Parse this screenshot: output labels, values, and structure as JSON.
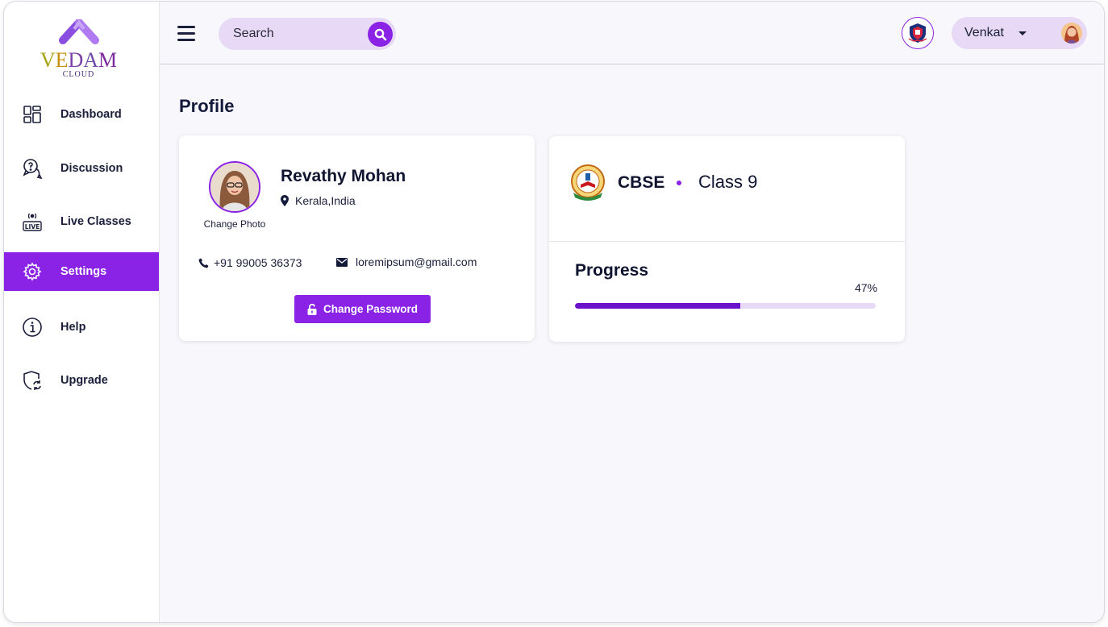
{
  "brand": {
    "name_letters": [
      "V",
      "E",
      "D",
      "A",
      "M"
    ],
    "letter_colors": [
      "#a7a414",
      "#c98d10",
      "#7a3fa8",
      "#6b4aa8",
      "#7d2a9e"
    ],
    "sub": "CLOUD",
    "accent": "#8a23e6"
  },
  "sidebar": {
    "items": [
      {
        "label": "Dashboard",
        "icon": "dashboard-icon",
        "active": false
      },
      {
        "label": "Discussion",
        "icon": "discussion-icon",
        "active": false
      },
      {
        "label": "Live Classes",
        "icon": "live-icon",
        "active": false
      },
      {
        "label": "Settings",
        "icon": "gear-icon",
        "active": true
      },
      {
        "label": "Help",
        "icon": "info-icon",
        "active": false
      },
      {
        "label": "Upgrade",
        "icon": "shield-refresh-icon",
        "active": false
      }
    ]
  },
  "header": {
    "search_placeholder": "Search",
    "user_name": "Venkat"
  },
  "page": {
    "title": "Profile"
  },
  "profile": {
    "name": "Revathy Mohan",
    "location": "Kerala,India",
    "change_photo": "Change Photo",
    "phone": "+91 99005 36373",
    "email": "loremipsum@gmail.com",
    "change_password": "Change Password"
  },
  "class_info": {
    "board": "CBSE",
    "class": "Class 9",
    "progress_title": "Progress",
    "progress_label": "47%",
    "progress_value": 0.55
  }
}
